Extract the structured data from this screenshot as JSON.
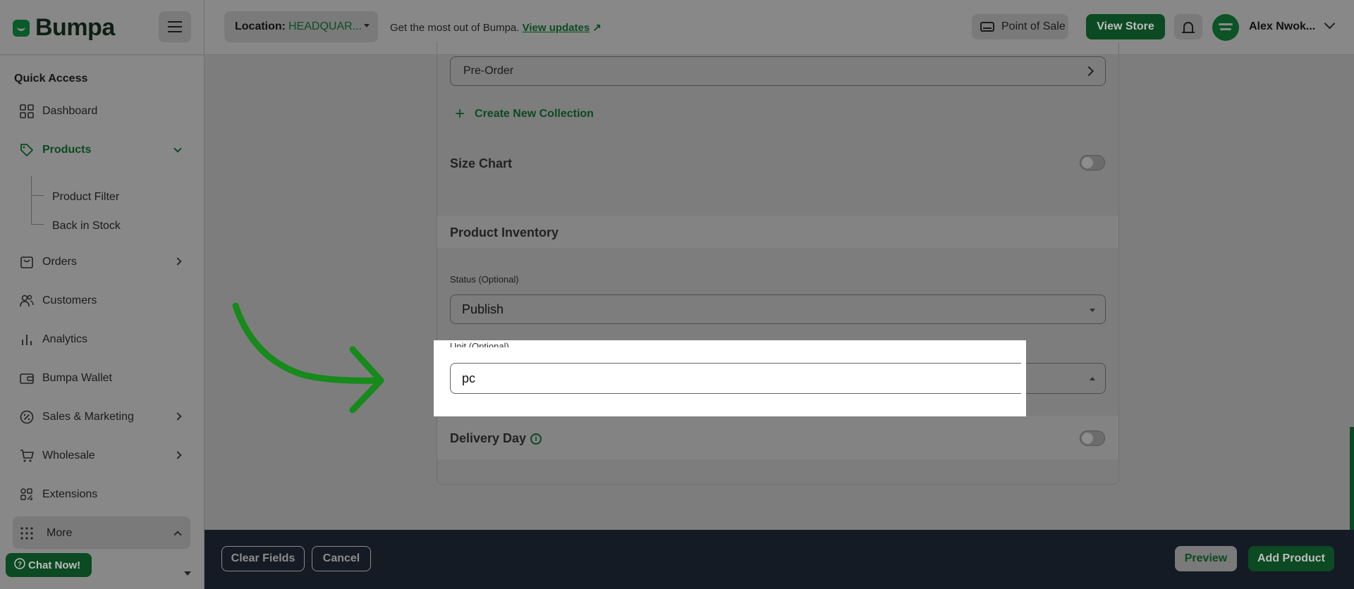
{
  "brand": {
    "name": "Bumpa"
  },
  "header": {
    "location_label": "Location:",
    "location_value": "HEADQUAR...",
    "promo_text": "Get the most out of Bumpa.",
    "promo_link": "View updates",
    "promo_arrow": "↗",
    "pos_label": "Point of Sale",
    "view_store_label": "View Store",
    "user_name": "Alex Nwok..."
  },
  "sidebar": {
    "quick_access": "Quick Access",
    "items": {
      "dashboard": "Dashboard",
      "products": "Products",
      "product_filter": "Product Filter",
      "back_in_stock": "Back in Stock",
      "orders": "Orders",
      "customers": "Customers",
      "analytics": "Analytics",
      "wallet": "Bumpa Wallet",
      "sales_marketing": "Sales & Marketing",
      "wholesale": "Wholesale",
      "extensions": "Extensions",
      "more": "More"
    },
    "chat_label": "Chat Now!"
  },
  "form": {
    "collection_value": "Pre-Order",
    "create_collection": "Create New Collection",
    "size_chart_label": "Size Chart",
    "size_chart_on": false,
    "inventory_title": "Product Inventory",
    "status_label": "Status (Optional)",
    "status_value": "Publish",
    "unit_label": "Unit (Optional)",
    "unit_value": "pc",
    "delivery_label": "Delivery Day",
    "delivery_on": false
  },
  "footer": {
    "clear_label": "Clear Fields",
    "cancel_label": "Cancel",
    "preview_label": "Preview",
    "add_label": "Add Product"
  },
  "colors": {
    "brand_green": "#0b4a22",
    "overlay_gray": "#7d7d7d",
    "footer_dark": "#151b24",
    "arrow_green": "#168a1b"
  }
}
